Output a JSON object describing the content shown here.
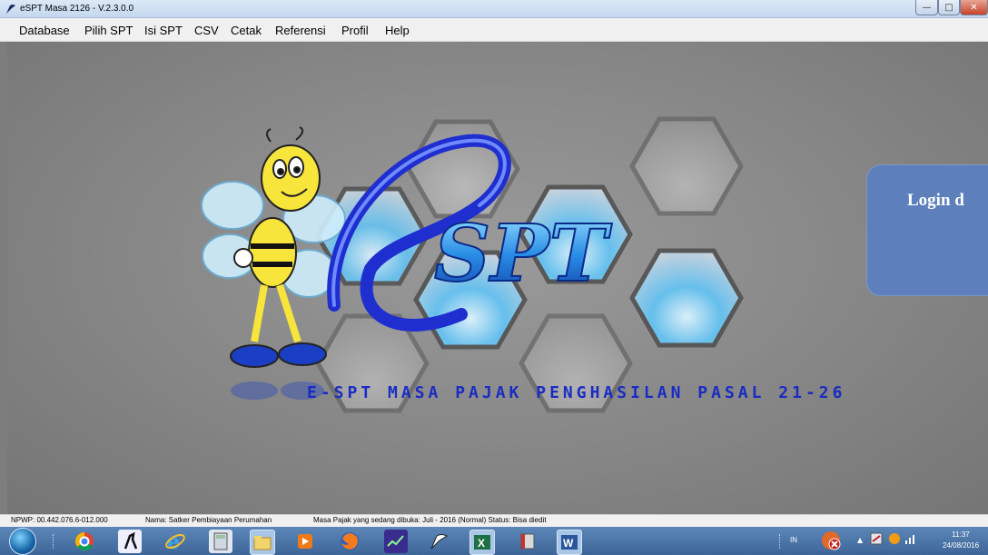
{
  "window": {
    "title": "eSPT Masa 2126 - V.2.3.0.0"
  },
  "menu": [
    "Database",
    "Pilih SPT",
    "Isi SPT",
    "CSV",
    "Cetak",
    "Referensi",
    "Profil",
    "Help"
  ],
  "splash": {
    "logo_text": "SPT",
    "tagline": "E-SPT MASA PAJAK PENGHASILAN PASAL 21-26",
    "login_label": "Login d"
  },
  "status": {
    "npwp": "NPWP: 00.442.076.6-012.000",
    "nama": "Nama: Satker Pembiayaan Perumahan",
    "masa": "Masa Pajak yang sedang dibuka: Juli - 2016 (Normal)  Status: Bisa diedit"
  },
  "taskbar": {
    "language": "IN",
    "time": "11:37",
    "date": "24/08/2016",
    "icons": [
      "chrome-icon",
      "counter-strike-icon",
      "ie-icon",
      "calculator-icon",
      "explorer-icon",
      "media-player-icon",
      "firefox-icon",
      "stock-chart-icon",
      "app-icon",
      "excel-icon",
      "book-icon",
      "word-icon"
    ]
  },
  "colors": {
    "accent_blue": "#1a2cc2",
    "login_bg": "#5d80bd"
  }
}
